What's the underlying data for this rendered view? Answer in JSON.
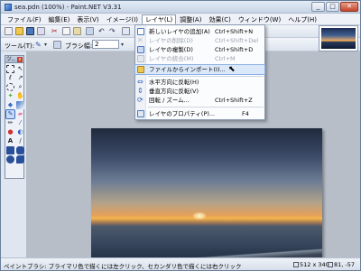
{
  "window": {
    "title": "sea.pdn (100%) - Paint.NET V3.31"
  },
  "menubar": [
    {
      "label": "ファイル(F)",
      "active": false
    },
    {
      "label": "編集(E)",
      "active": false
    },
    {
      "label": "表示(V)",
      "active": false
    },
    {
      "label": "イメージ(I)",
      "active": false
    },
    {
      "label": "レイヤ(L)",
      "active": true
    },
    {
      "label": "調整(A)",
      "active": false
    },
    {
      "label": "効果(C)",
      "active": false
    },
    {
      "label": "ウィンドウ(W)",
      "active": false
    },
    {
      "label": "ヘルプ(H)",
      "active": false
    }
  ],
  "toolbar": {
    "tool_label": "ツール(T):",
    "brush_label": "ブラシ幅:",
    "brush_width": "2"
  },
  "toolspanel": {
    "title": "ツ..",
    "close": "x"
  },
  "layer_menu": {
    "items": [
      {
        "label": "新しいレイヤの追加(A)",
        "shortcut": "Ctrl+Shift+N",
        "disabled": false
      },
      {
        "label": "レイヤの削除(D)",
        "shortcut": "Ctrl+Shift+Del",
        "disabled": true
      },
      {
        "label": "レイヤの複製(D)",
        "shortcut": "Ctrl+Shift+D",
        "disabled": false
      },
      {
        "label": "レイヤの統合(M)",
        "shortcut": "Ctrl+M",
        "disabled": true
      },
      {
        "label": "ファイルからインポート(I)...",
        "shortcut": "",
        "disabled": false,
        "hover": true
      },
      {
        "label": "水平方向に反転(H)",
        "shortcut": "",
        "disabled": false
      },
      {
        "label": "垂直方向に反転(V)",
        "shortcut": "",
        "disabled": false
      },
      {
        "label": "回転 / ズーム...",
        "shortcut": "Ctrl+Shift+Z",
        "disabled": false
      },
      {
        "label": "レイヤのプロパティ(P)...",
        "shortcut": "F4",
        "disabled": false
      }
    ]
  },
  "status": {
    "hint": "ペイントブラシ: プライマリ色で描くには左クリック、セカンダリ色で描くには右クリック",
    "size": "512 x 340",
    "position": "81, -57"
  },
  "colors": {
    "accent": "#3c6bc0",
    "hover": "#dbe8fa"
  }
}
